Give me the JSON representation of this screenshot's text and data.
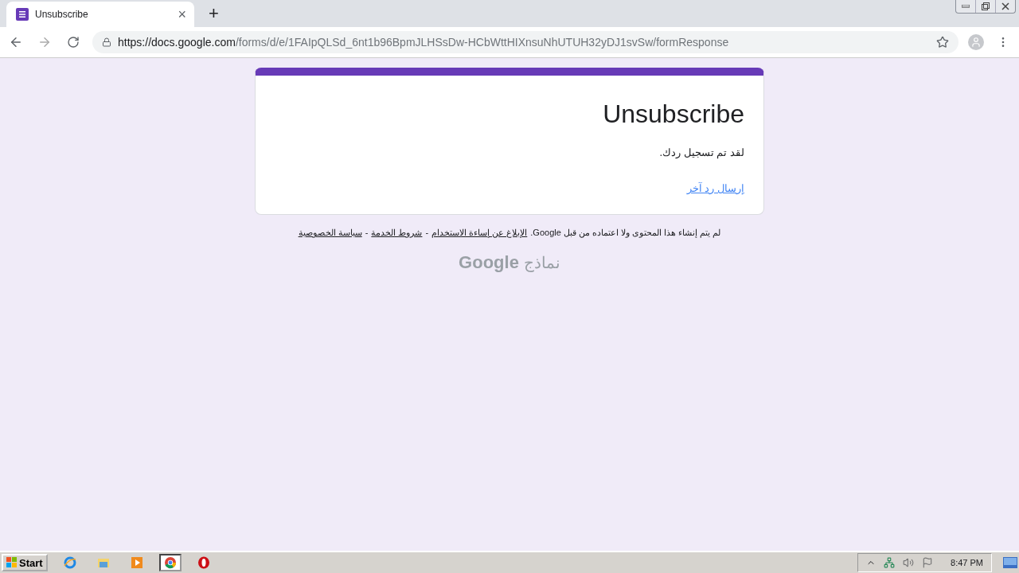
{
  "browser": {
    "tab": {
      "title": "Unsubscribe",
      "close": "×"
    },
    "new_tab": "+",
    "url": {
      "host": "https://docs.google.com",
      "path": "/forms/d/e/1FAIpQLSd_6nt1b96BpmJLHSsDw-HCbWttHIXnsuNhUTUH32yDJ1svSw/formResponse"
    }
  },
  "form": {
    "title": "Unsubscribe",
    "message": "لقد تم تسجيل ردك.",
    "link": "إرسال رد آخر"
  },
  "footer": {
    "disclaimer": "لم يتم إنشاء هذا المحتوى ولا اعتماده من قبل Google.",
    "links": [
      "الإبلاغ عن إساءة الاستخدام",
      "شروط الخدمة",
      "سياسة الخصوصية"
    ],
    "separator": "-"
  },
  "brand": {
    "name": "Google",
    "product": "نماذج"
  },
  "taskbar": {
    "start": "Start",
    "apps": [
      {
        "kind": "ie",
        "selected": false
      },
      {
        "kind": "folder",
        "selected": false
      },
      {
        "kind": "media",
        "selected": false
      },
      {
        "kind": "chrome",
        "selected": true
      },
      {
        "kind": "opera",
        "selected": false
      }
    ],
    "clock": "8:47 PM"
  }
}
